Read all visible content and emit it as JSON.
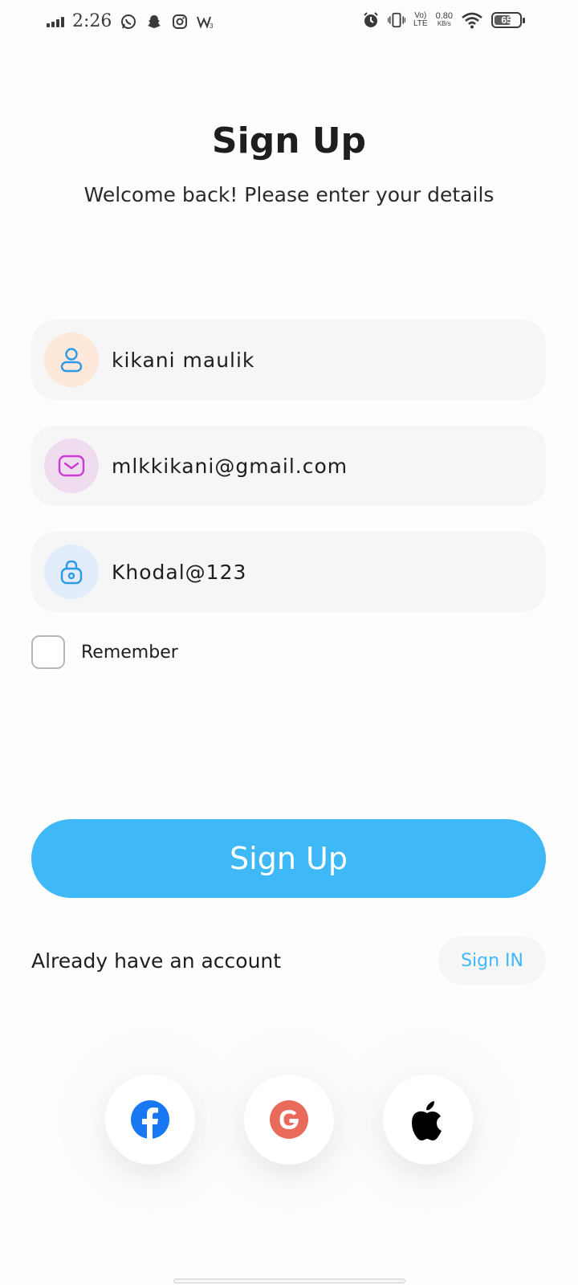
{
  "status_bar": {
    "time": "2:26",
    "net_speed": "0.80",
    "net_unit": "KB/s",
    "volte_top": "Vo)",
    "volte_bottom": "LTE",
    "battery": "65",
    "battery_level": 0.65,
    "notification_icons": [
      "whatsapp-icon",
      "snapchat-icon",
      "instagram-icon",
      "w-app-icon"
    ],
    "system_icons": [
      "alarm-icon",
      "vibrate-icon",
      "volte-icon",
      "wifi-icon",
      "battery-icon"
    ]
  },
  "header": {
    "title": "Sign Up",
    "subtitle": "Welcome back! Please enter your details"
  },
  "form": {
    "name_value": "kikani maulik",
    "email_value": "mlkkikani@gmail.com",
    "password_value": "Khodal@123",
    "remember_label": "Remember",
    "remember_checked": false
  },
  "actions": {
    "signup_label": "Sign Up",
    "account_text": "Already have an account",
    "signin_label": "Sign IN"
  },
  "social": [
    "facebook-icon",
    "google-icon",
    "apple-icon"
  ],
  "colors": {
    "accent": "#3fb8f7",
    "name_icon_bg": "#fde8da",
    "email_icon_bg": "#efdcef",
    "password_icon_bg": "#e3ecfb",
    "facebook": "#1877f2",
    "google": "#ea6a5a"
  }
}
